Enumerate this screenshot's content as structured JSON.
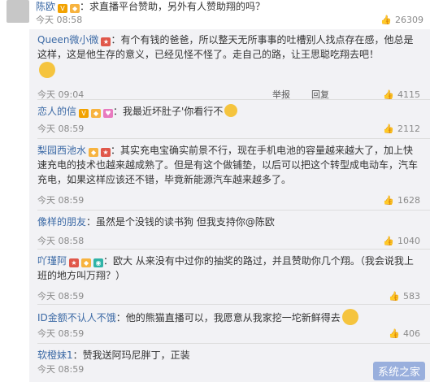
{
  "main_comment": {
    "name": "陈欧",
    "text": "：求直播平台赞助，另外有人赞助翔的吗？",
    "time": "今天 08:58",
    "likes": "26309"
  },
  "replies": [
    {
      "name": "Queen微小微",
      "text": "：有个有钱的爸爸，所以整天无所事事的吐槽别人找点存在感，他总是这样，这是他生存的意义，已经见怪不怪了。走自己的路，让王思聪吃翔去吧！",
      "time": "今天 09:04",
      "likes": "4115",
      "report": "举报",
      "reply": "回复"
    },
    {
      "name": "恋人的信",
      "text": "：我最近坏肚子'你看行不",
      "time": "今天 08:59",
      "likes": "2112"
    },
    {
      "name": "梨园西池水",
      "text": "：其实充电宝确实前景不行，现在手机电池的容量越来越大了，加上快速充电的技术也越来越成熟了。但是有这个做铺垫，以后可以把这个转型成电动车，汽车充电，如果这样应该还不错，毕竟新能源汽车越来越多了。",
      "time": "今天 08:59",
      "likes": "1628"
    },
    {
      "name": "像样的朋友",
      "text": "：虽然是个没钱的读书狗 但我支持你@陈欧",
      "time": "今天 08:58",
      "likes": "1040"
    },
    {
      "name": "吖瑾阿",
      "text": "：欧大 从来没有中过你的抽奖的路过，并且赞助你几个翔。（我会说我上班的地方叫万翔？）",
      "time": "今天 08:59",
      "likes": "583"
    },
    {
      "name": "ID金额不认人不饿",
      "text": "：他的熊猫直播可以，我愿意从我家挖一坨新鲜得去",
      "time": "今天 08:59",
      "likes": "406"
    },
    {
      "name": "软橙妹1",
      "text": "：赞我送阿玛尼胖丁，正装",
      "time": "今天 08:59",
      "likes": ""
    }
  ],
  "watermark": "系统之家",
  "colors": {
    "name_link": "#3b69a5",
    "reply_bg": "#f2f2f5",
    "meta": "#8a8a8a"
  },
  "icons": {
    "like": "thumbs-up-icon"
  }
}
